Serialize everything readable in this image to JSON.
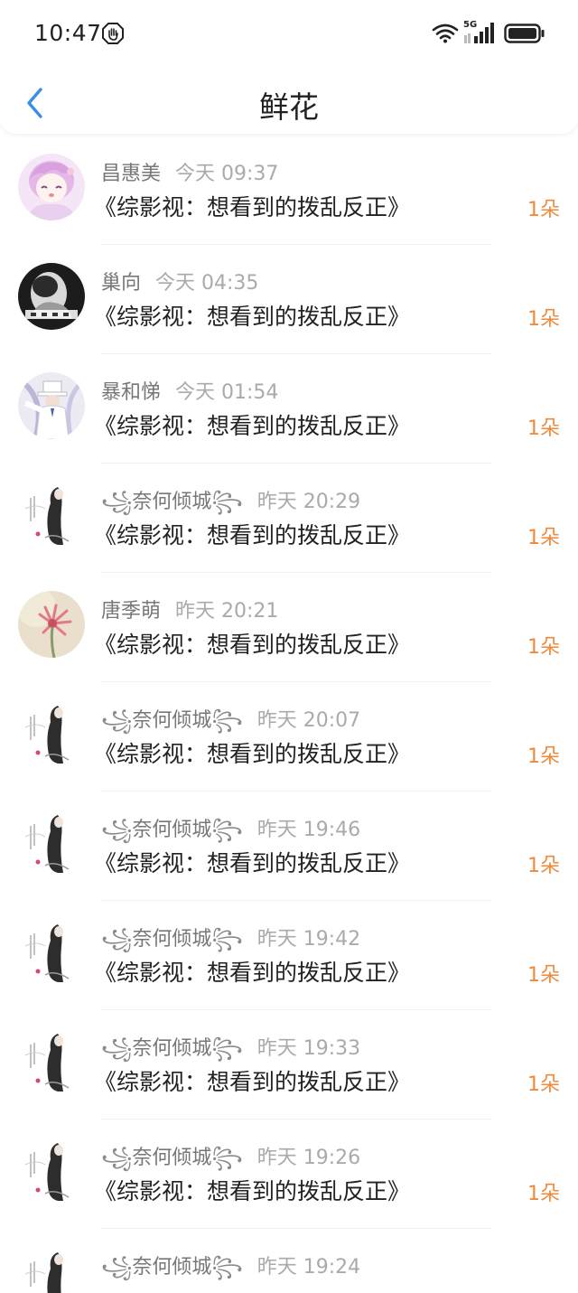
{
  "status_bar": {
    "time": "10:47",
    "network": "5G",
    "icons": [
      "hand-stop-icon",
      "wifi-icon",
      "signal-icon",
      "battery-icon"
    ]
  },
  "header": {
    "title": "鲜花",
    "back_icon": "chevron-left-icon"
  },
  "colors": {
    "accent": "#3a8ee6",
    "count": "#ee8a3c",
    "meta": "#777777",
    "timestamp": "#aaaaaa"
  },
  "items": [
    {
      "name": "昌惠美",
      "time": "今天 09:37",
      "book": "《综影视：想看到的拨乱反正》",
      "count": "1朵"
    },
    {
      "name": "巢向",
      "time": "今天 04:35",
      "book": "《综影视：想看到的拨乱反正》",
      "count": "1朵"
    },
    {
      "name": "暴和悌",
      "time": "今天 01:54",
      "book": "《综影视：想看到的拨乱反正》",
      "count": "1朵"
    },
    {
      "name": "奈何倾城",
      "time": "昨天 20:29",
      "book": "《综影视：想看到的拨乱反正》",
      "count": "1朵"
    },
    {
      "name": "唐季萌",
      "time": "昨天 20:21",
      "book": "《综影视：想看到的拨乱反正》",
      "count": "1朵"
    },
    {
      "name": "奈何倾城",
      "time": "昨天 20:07",
      "book": "《综影视：想看到的拨乱反正》",
      "count": "1朵"
    },
    {
      "name": "奈何倾城",
      "time": "昨天 19:46",
      "book": "《综影视：想看到的拨乱反正》",
      "count": "1朵"
    },
    {
      "name": "奈何倾城",
      "time": "昨天 19:42",
      "book": "《综影视：想看到的拨乱反正》",
      "count": "1朵"
    },
    {
      "name": "奈何倾城",
      "time": "昨天 19:33",
      "book": "《综影视：想看到的拨乱反正》",
      "count": "1朵"
    },
    {
      "name": "奈何倾城",
      "time": "昨天 19:26",
      "book": "《综影视：想看到的拨乱反正》",
      "count": "1朵"
    },
    {
      "name": "奈何倾城",
      "time": "昨天 19:24",
      "book": "",
      "count": ""
    }
  ]
}
